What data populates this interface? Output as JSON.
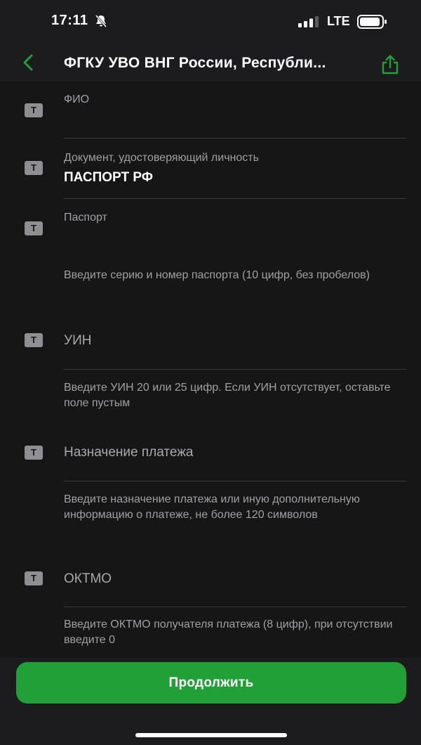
{
  "status_bar": {
    "time": "17:11",
    "network": "LTE",
    "icons": [
      "bell-slash-icon",
      "signal-icon",
      "battery-icon"
    ]
  },
  "nav": {
    "title": "ФГКУ УВО ВНГ России, Республи...",
    "back_icon": "chevron-left-icon",
    "share_icon": "share-icon"
  },
  "fields": {
    "fio": {
      "label": "ФИО",
      "value": ""
    },
    "document": {
      "label": "Документ, удостоверяющий личность",
      "value": "ПАСПОРТ РФ"
    },
    "passport": {
      "label": "Паспорт",
      "value": "",
      "hint": "Введите серию и номер паспорта (10 цифр, без пробелов)"
    },
    "uin": {
      "placeholder": "УИН",
      "hint": "Введите УИН 20 или 25 цифр. Если УИН отсутствует, оставьте поле пустым"
    },
    "purpose": {
      "placeholder": "Назначение платежа",
      "hint": "Введите назначение платежа или иную дополнительную информацию о платеже, не более 120 символов"
    },
    "oktmo": {
      "placeholder": "ОКТМО",
      "hint": "Введите ОКТМО получателя платежа (8 цифр), при отсутствии введите 0"
    }
  },
  "field_icon_glyph": "T",
  "actions": {
    "continue_label": "Продолжить"
  },
  "colors": {
    "accent": "#21a038",
    "background": "#161616",
    "header_background": "#1c1c1e",
    "text_secondary": "#a0a0a5"
  }
}
